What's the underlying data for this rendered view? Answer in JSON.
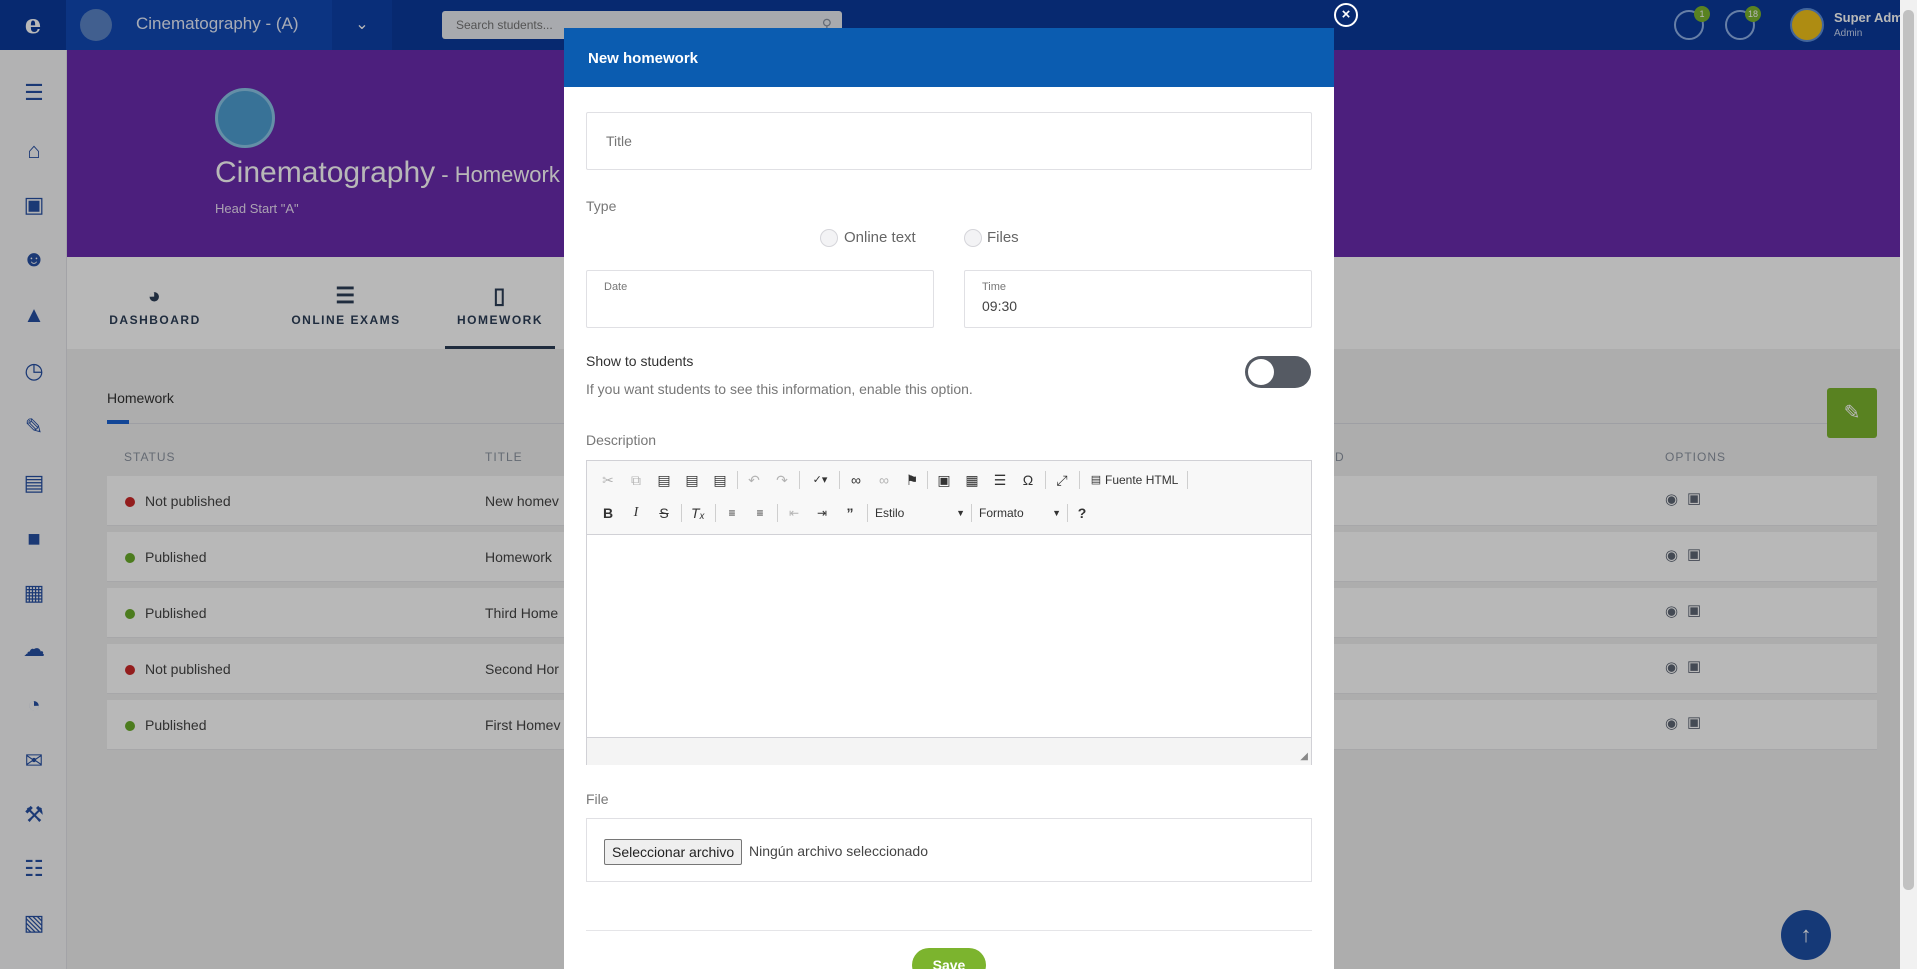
{
  "topbar": {
    "course_name": "Cinematography - (A)",
    "search_placeholder": "Search students...",
    "notifications": [
      {
        "icon": "chat-icon",
        "badge": "1"
      },
      {
        "icon": "globe-icon",
        "badge": "18"
      }
    ],
    "user_name": "Super Admi",
    "user_role": "Admin"
  },
  "header": {
    "title": "Cinematography",
    "separator": " - ",
    "subtitle": "Homework",
    "group": "Head Start \"A\""
  },
  "tabs": [
    {
      "label": "DASHBOARD",
      "icon": "gauge-icon"
    },
    {
      "label": "ONLINE EXAMS",
      "icon": "checklist-icon"
    },
    {
      "label": "HOMEWORK",
      "icon": "notebook-icon",
      "active": true
    }
  ],
  "content": {
    "section_title": "Homework",
    "columns": [
      "STATUS",
      "TITLE",
      "D",
      "OPTIONS"
    ],
    "rows": [
      {
        "status": "Not published",
        "status_color": "#cc2929",
        "title": "New homev"
      },
      {
        "status": "Published",
        "status_color": "#6aac2a",
        "title": "Homework"
      },
      {
        "status": "Published",
        "status_color": "#6aac2a",
        "title": "Third Home"
      },
      {
        "status": "Not published",
        "status_color": "#cc2929",
        "title": "Second Hor"
      },
      {
        "status": "Published",
        "status_color": "#6aac2a",
        "title": "First Homev"
      }
    ]
  },
  "modal": {
    "title": "New homework",
    "title_placeholder": "Title",
    "type_label": "Type",
    "type_options": [
      "Online text",
      "Files"
    ],
    "date_label": "Date",
    "date_value": "",
    "time_label": "Time",
    "time_value": "09:30",
    "show_label": "Show to students",
    "show_help": "If you want students to see this information, enable this option.",
    "show_enabled": false,
    "description_label": "Description",
    "editor": {
      "html_source_label": "Fuente HTML",
      "style_combo": "Estilo",
      "format_combo": "Formato",
      "help_glyph": "?"
    },
    "file_label": "File",
    "file_button": "Seleccionar archivo",
    "file_status": "Ningún archivo seleccionado",
    "save_label": "Save"
  },
  "colors": {
    "topbar": "#0a3a9c",
    "header_band": "#6a2bad",
    "modal_header": "#0b5cb0",
    "accent_green": "#7cb42e"
  }
}
